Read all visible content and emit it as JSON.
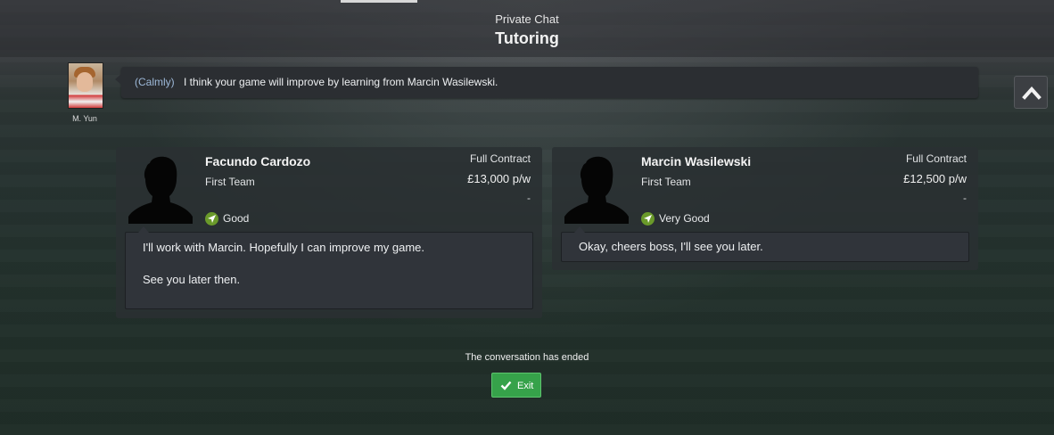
{
  "header": {
    "subtitle": "Private Chat",
    "title": "Tutoring"
  },
  "speaker": {
    "name": "M. Yun",
    "mood": "(Calmly)",
    "message": "I think your game will improve by learning from Marcin Wasilewski."
  },
  "players": [
    {
      "name": "Facundo Cardozo",
      "squad": "First Team",
      "contract": "Full Contract",
      "wage": "£13,000 p/w",
      "extra": "-",
      "rating": "Good",
      "reply_lines": [
        "I'll work with Marcin. Hopefully I can improve my game.",
        "See you later then."
      ]
    },
    {
      "name": "Marcin Wasilewski",
      "squad": "First Team",
      "contract": "Full Contract",
      "wage": "£12,500 p/w",
      "extra": "-",
      "rating": "Very Good",
      "reply_lines": [
        "Okay, cheers boss, I'll see you later."
      ]
    }
  ],
  "footer": {
    "status": "The conversation has ended",
    "exit_label": "Exit"
  },
  "icons": {
    "scroll": "chevron-up-icon",
    "rating": "navigation-arrow-icon",
    "exit": "check-icon",
    "portrait": "player-silhouette-icon"
  },
  "colors": {
    "rating_green": "#6a9a2a",
    "exit_green": "#36a24a",
    "mood_blue": "#9db8d8"
  }
}
